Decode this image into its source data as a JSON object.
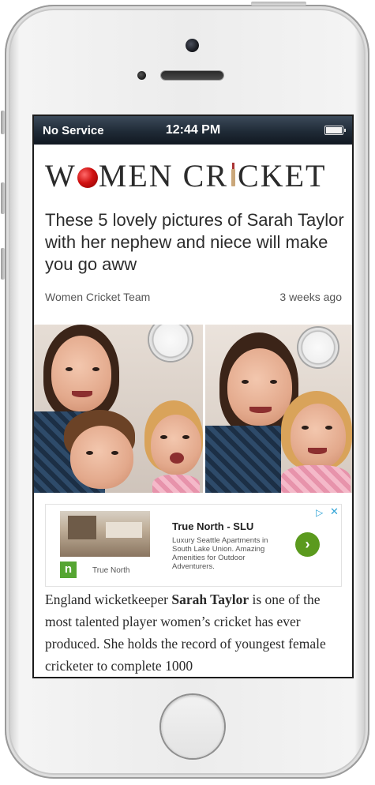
{
  "status_bar": {
    "carrier": "No Service",
    "time": "12:44 PM",
    "battery_level": 1.0
  },
  "site": {
    "logo_text": "WOMEN CRICKET",
    "logo_parts": [
      "W",
      "MEN CR",
      "CKET"
    ]
  },
  "article": {
    "headline": "These 5 lovely pictures of Sarah Taylor with her nephew and niece will make you go aww",
    "author": "Women Cricket Team",
    "published": "3 weeks ago",
    "body_intro": "England wicketkeeper ",
    "body_bold": "Sarah Taylor",
    "body_rest": " is one of the most talented player women’s cricket has ever produced. She holds the record of youngest female cricketer to complete 1000"
  },
  "ad": {
    "title": "True North - SLU",
    "description": "Luxury Seattle Apartments in South Lake Union. Amazing Amenities for Outdoor Adventurers.",
    "brand": "True North",
    "logo_letter": "n",
    "go_symbol": "›",
    "choice_symbol": "▷",
    "close_symbol": "✕",
    "brand_color": "#55a532",
    "button_color": "#5b9a1e"
  },
  "icons": {
    "battery": "battery-icon",
    "ad_choices": "ad-choices-icon",
    "close": "close-icon",
    "go": "chevron-right-icon"
  }
}
